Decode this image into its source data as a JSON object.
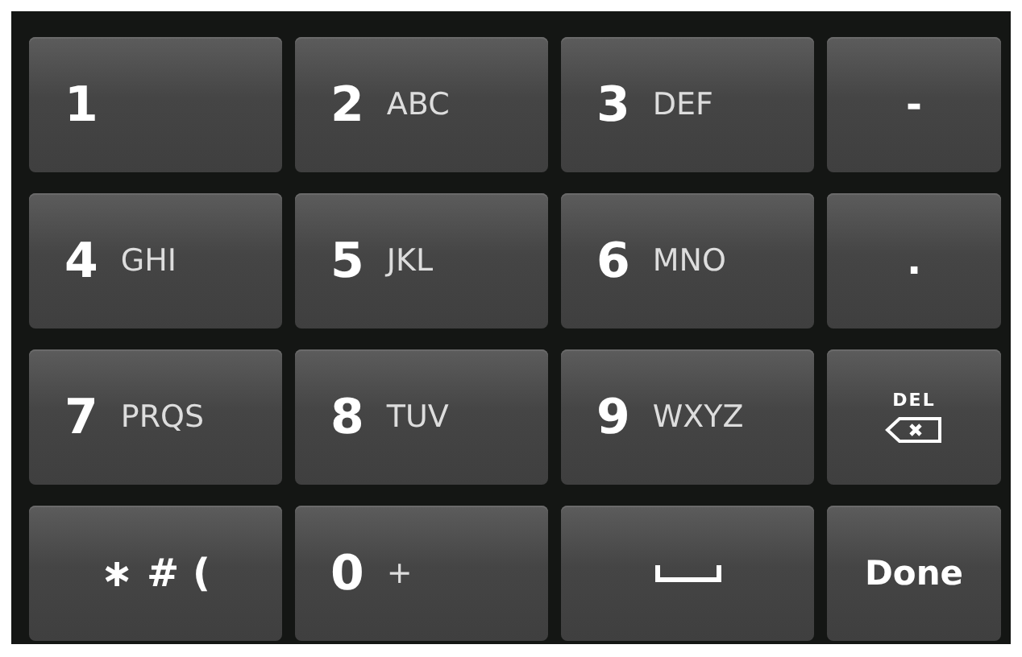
{
  "rows": [
    {
      "keys": [
        {
          "kind": "digit",
          "digit": "1"
        },
        {
          "kind": "digit",
          "digit": "2",
          "letters": "ABC"
        },
        {
          "kind": "digit",
          "digit": "3",
          "letters": "DEF"
        },
        {
          "kind": "symbol",
          "label": "-"
        }
      ]
    },
    {
      "keys": [
        {
          "kind": "digit",
          "digit": "4",
          "letters": "GHI"
        },
        {
          "kind": "digit",
          "digit": "5",
          "letters": "JKL"
        },
        {
          "kind": "digit",
          "digit": "6",
          "letters": "MNO"
        },
        {
          "kind": "symbol",
          "label": "."
        }
      ]
    },
    {
      "keys": [
        {
          "kind": "digit",
          "digit": "7",
          "letters": "PRQS"
        },
        {
          "kind": "digit",
          "digit": "8",
          "letters": "TUV"
        },
        {
          "kind": "digit",
          "digit": "9",
          "letters": "WXYZ"
        },
        {
          "kind": "delete",
          "label": "DEL"
        }
      ]
    },
    {
      "keys": [
        {
          "kind": "symbol",
          "label": "∗ # ("
        },
        {
          "kind": "digit",
          "digit": "0",
          "letters": "+"
        },
        {
          "kind": "space"
        },
        {
          "kind": "action",
          "label": "Done"
        }
      ]
    }
  ]
}
